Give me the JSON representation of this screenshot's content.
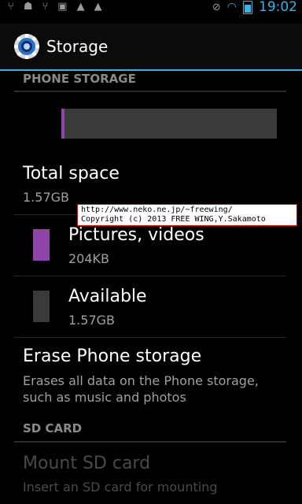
{
  "status_bar": {
    "left_icons": [
      "usb-icon",
      "android-debug-icon",
      "usb-icon",
      "image-icon",
      "warning-icon",
      "warning-icon"
    ],
    "time": "19:02"
  },
  "action_bar": {
    "title": "Storage",
    "icon": "settings-gear-icon"
  },
  "phone_storage": {
    "header": "PHONE STORAGE",
    "used_fraction": 0.015,
    "total": {
      "title": "Total space",
      "value": "1.57GB"
    },
    "pictures": {
      "title": "Pictures, videos",
      "value": "204KB",
      "color": "#8e44a8"
    },
    "available": {
      "title": "Available",
      "value": "1.57GB",
      "color": "#3a3a3a"
    },
    "erase": {
      "title": "Erase Phone storage",
      "description_line1": "Erases all data on the Phone storage,",
      "description_line2": "such as music and photos"
    }
  },
  "sd_card": {
    "header": "SD CARD",
    "mount": {
      "title": "Mount SD card",
      "description": "Insert an SD card for mounting"
    }
  },
  "watermark": {
    "line1": "http://www.neko.ne.jp/~freewing/",
    "line2": "Copyright (c) 2013 FREE WING,Y.Sakamoto"
  },
  "colors": {
    "accent": "#33b5e5",
    "pictures": "#8e44a8",
    "background": "#000000"
  }
}
